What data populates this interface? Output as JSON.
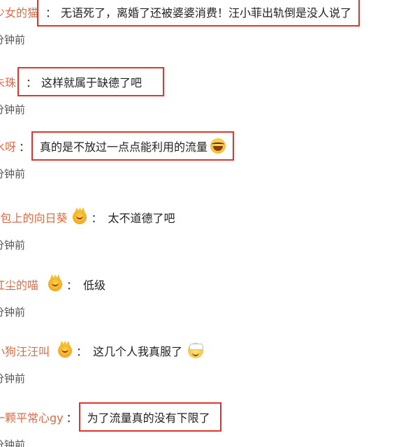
{
  "comments": [
    {
      "username": "少女的猫",
      "text": "无语死了，离婚了还被婆婆消费！汪小菲出轨倒是没人说了",
      "time": "分钟前",
      "badge": null,
      "highlighted": true,
      "emoji": null
    },
    {
      "username": "朱珠",
      "text": "这样就属于缺德了吧",
      "time": "分钟前",
      "badge": null,
      "highlighted": true,
      "emoji": null
    },
    {
      "username": "水呀",
      "text": "真的是不放过一点点能利用的流量",
      "time": "分钟前",
      "badge": null,
      "highlighted": true,
      "emoji": "laughing-crying-emoji"
    },
    {
      "username": "JJ包上的向日葵",
      "text": "太不道德了吧",
      "time": "分钟前",
      "badge": "crown-badge-icon",
      "highlighted": false,
      "emoji": null
    },
    {
      "username": "红尘的喵",
      "text": "低级",
      "time": "分钟前",
      "badge": "crown-badge-icon",
      "highlighted": false,
      "emoji": null
    },
    {
      "username": "小狗汪汪叫",
      "text": "这几个人我真服了",
      "time": "分钟前",
      "badge": "crown-badge-icon",
      "highlighted": false,
      "emoji": "sick-face-emoji"
    },
    {
      "username": "一颗平常心gy",
      "text": "为了流量真的没有下限了",
      "time": "分钟前",
      "badge": null,
      "highlighted": true,
      "emoji": null
    }
  ],
  "colors": {
    "username": "#e06a43",
    "highlight_border": "#e0342c",
    "text": "#222222",
    "time": "#555555"
  }
}
